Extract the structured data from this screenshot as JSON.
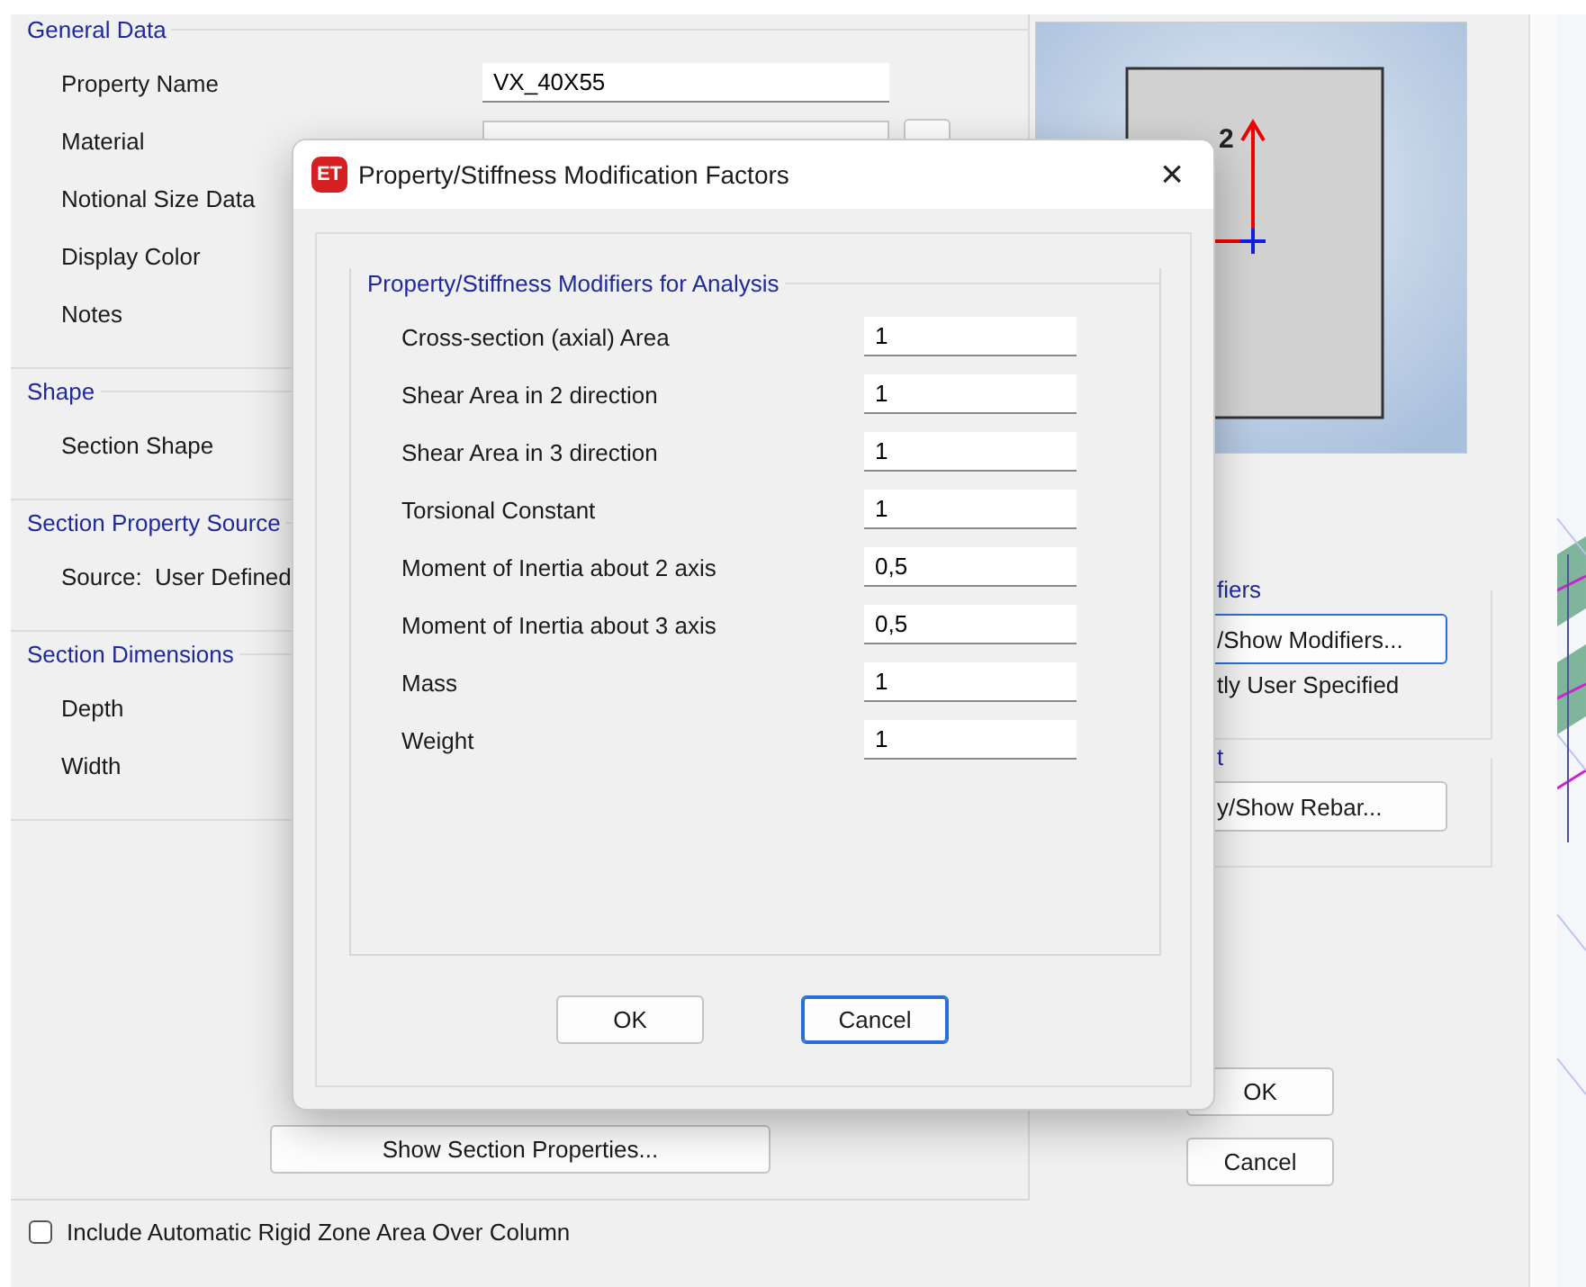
{
  "form": {
    "groups": [
      {
        "legend": "General Data",
        "rows": [
          {
            "label": "Property Name",
            "kind": "field",
            "value": "VX_40X55"
          },
          {
            "label": "Material",
            "kind": "select"
          },
          {
            "label": "Notional Size Data",
            "kind": "label"
          },
          {
            "label": "Display Color",
            "kind": "label"
          },
          {
            "label": "Notes",
            "kind": "label"
          }
        ]
      },
      {
        "legend": "Shape",
        "rows": [
          {
            "label": "Section Shape",
            "kind": "label"
          }
        ]
      },
      {
        "legend": "Section Property Source",
        "rows": [
          {
            "label": "Source:  User Defined",
            "kind": "label"
          }
        ]
      },
      {
        "legend": "Section Dimensions",
        "rows": [
          {
            "label": "Depth",
            "kind": "label"
          },
          {
            "label": "Width",
            "kind": "label"
          }
        ]
      }
    ],
    "show_section_button": "Show Section Properties...",
    "preview": {
      "axis_label": "2"
    },
    "modifiers_group": {
      "legend": "fiers",
      "button": "/Show Modifiers...",
      "status": "tly User Specified"
    },
    "rebar_group": {
      "legend": "t",
      "button": "y/Show Rebar..."
    },
    "buttons": [
      "OK",
      "Cancel"
    ],
    "checkbox": {
      "label": "Include Automatic Rigid Zone Area Over Column",
      "checked": false
    }
  },
  "dialog": {
    "icon_text": "ET",
    "title": "Property/Stiffness Modification Factors",
    "close": "×",
    "legend": "Property/Stiffness Modifiers for Analysis",
    "rows": [
      {
        "label": "Cross-section (axial) Area",
        "value": "1"
      },
      {
        "label": "Shear Area in 2 direction",
        "value": "1"
      },
      {
        "label": "Shear Area in 3 direction",
        "value": "1"
      },
      {
        "label": "Torsional Constant",
        "value": "1"
      },
      {
        "label": "Moment of Inertia about 2 axis",
        "value": "0,5"
      },
      {
        "label": "Moment of Inertia about 3 axis",
        "value": "0,5"
      },
      {
        "label": "Mass",
        "value": "1"
      },
      {
        "label": "Weight",
        "value": "1"
      }
    ],
    "buttons": [
      {
        "label": "OK",
        "focused": false
      },
      {
        "label": "Cancel",
        "focused": true
      }
    ]
  }
}
